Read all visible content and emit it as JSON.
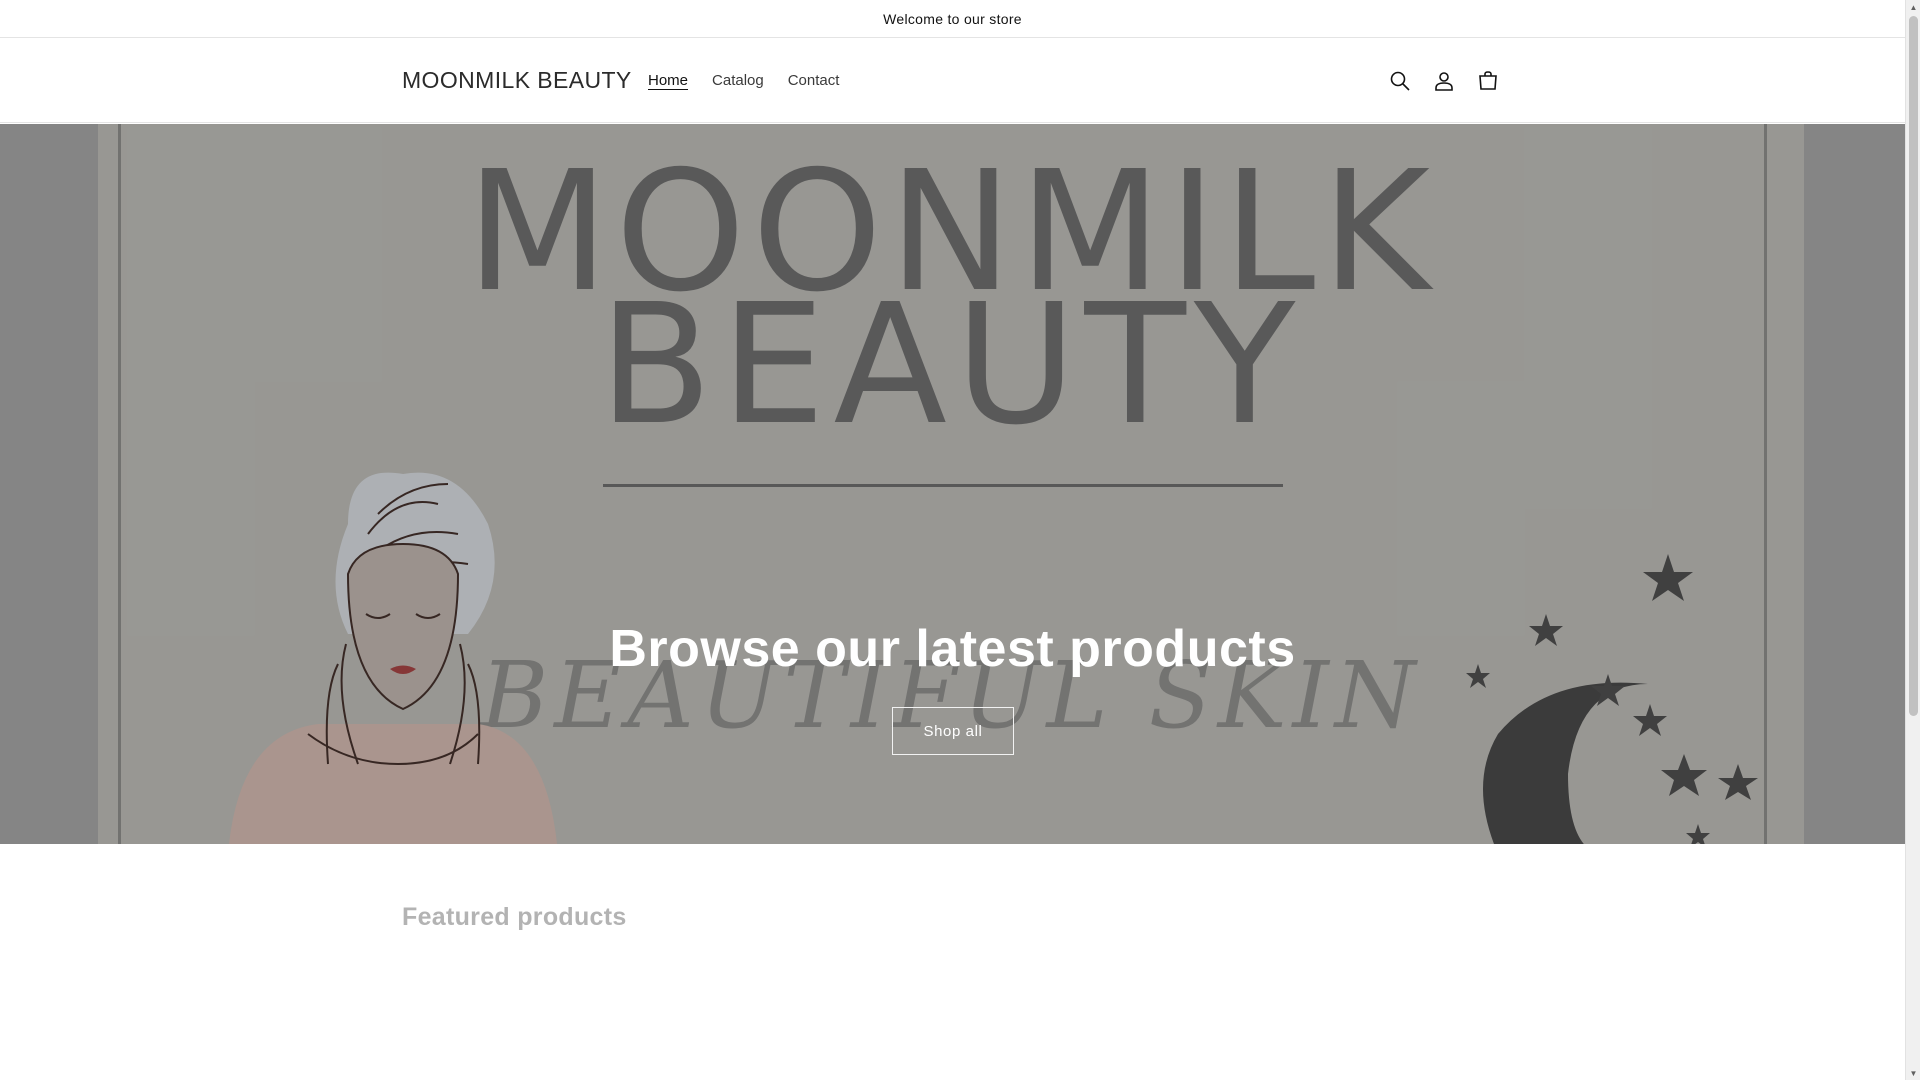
{
  "announcement": {
    "text": "Welcome to our store"
  },
  "header": {
    "logo": "MOONMILK BEAUTY",
    "nav": [
      {
        "label": "Home",
        "active": true
      },
      {
        "label": "Catalog",
        "active": false
      },
      {
        "label": "Contact",
        "active": false
      }
    ],
    "icons": [
      "search-icon",
      "account-icon",
      "cart-icon"
    ]
  },
  "hero": {
    "image_text_line1": "MOONMILK",
    "image_text_line2": "BEAUTY",
    "image_script": "BEAUTIFUL SKIN",
    "heading": "Browse our latest products",
    "button_label": "Shop all"
  },
  "featured": {
    "title": "Featured products"
  },
  "colors": {
    "background": "#ffffff",
    "hero_bg": "#a2a19d",
    "hero_side": "#8e8e8e",
    "text": "#121212",
    "featured_title": "#b3b3b3"
  }
}
